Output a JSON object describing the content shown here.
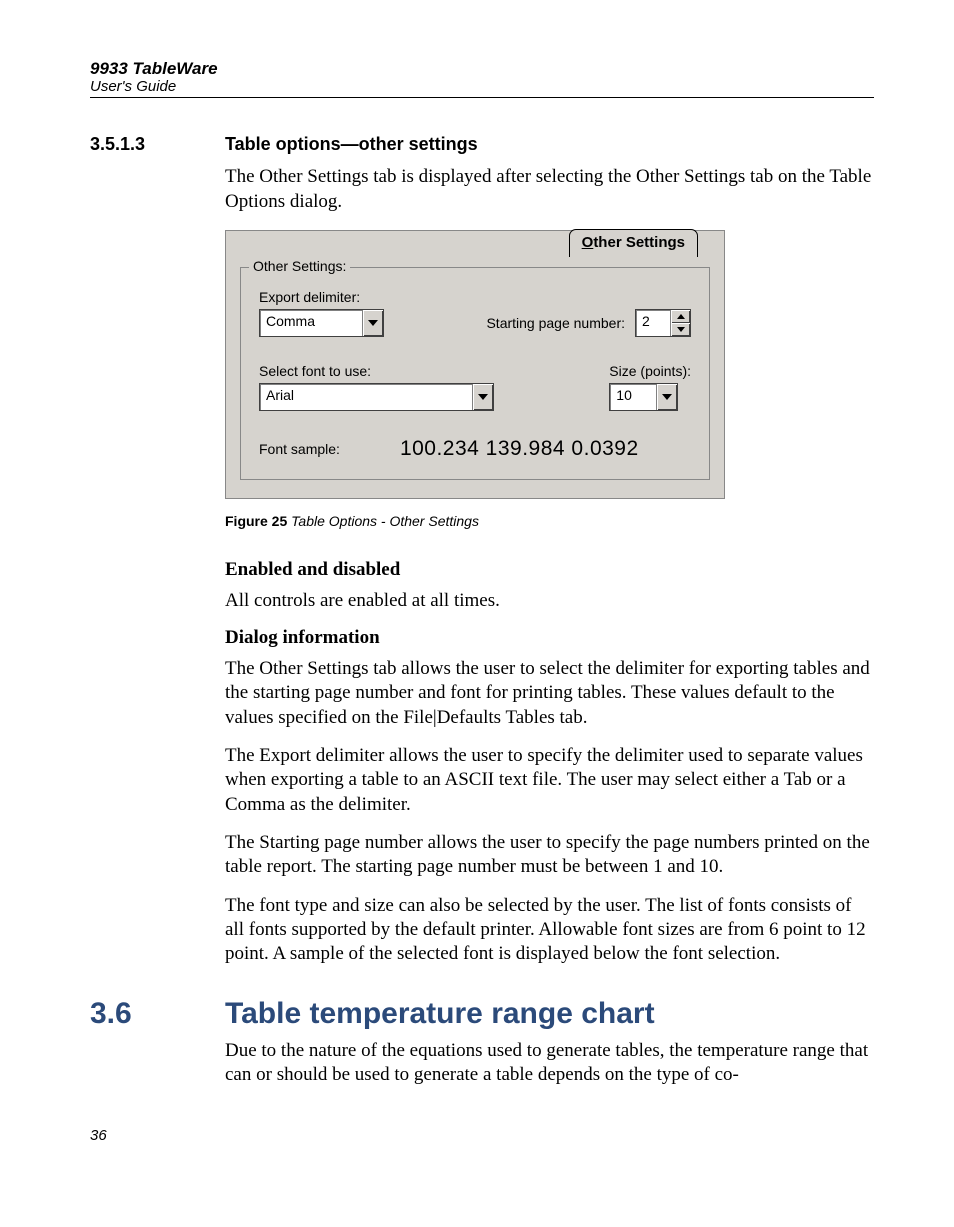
{
  "running_head": {
    "title": "9933 TableWare",
    "sub": "User's Guide"
  },
  "sec3513": {
    "num": "3.5.1.3",
    "title": "Table options—other settings",
    "intro": "The Other Settings tab is displayed after selecting the Other Settings  tab on the Table Options dialog."
  },
  "dialog": {
    "tab_prefix": "O",
    "tab_rest": "ther Settings",
    "group_legend": "Other Settings:",
    "export_label": "Export delimiter:",
    "export_value": "Comma",
    "start_label": "Starting page number:",
    "start_value": "2",
    "font_label": "Select font to use:",
    "font_value": "Arial",
    "size_label": "Size (points):",
    "size_value": "10",
    "sample_label": "Font sample:",
    "sample_value": "100.234 139.984 0.0392"
  },
  "figcap": {
    "bold": "Figure 25",
    "rest": "   Table Options - Other Settings"
  },
  "enabled": {
    "head": "Enabled and disabled",
    "body": "All controls are enabled at all times."
  },
  "info": {
    "head": "Dialog information",
    "p1": "The Other Settings tab allows the user to select the delimiter for exporting tables and the starting page number and font for printing tables. These values default to the values specified on the File|Defaults Tables tab.",
    "p2": "The Export delimiter allows the user to specify the delimiter used to separate values when exporting a table to an ASCII text file. The user may select either a Tab or a Comma as the delimiter.",
    "p3": "The Starting page number allows the user to specify the page numbers printed on the table report. The starting page number must be between 1 and 10.",
    "p4": "The font type and size can also be selected by the user. The list of fonts consists of all fonts supported by the default printer. Allowable font sizes are from 6 point to 12 point. A sample of the selected font is displayed below the font selection."
  },
  "sec36": {
    "num": "3.6",
    "title": "Table temperature range chart",
    "body": "Due to the nature of the equations used to generate tables, the temperature range that can or should be used to generate a table depends on the type of co-"
  },
  "page_number": "36"
}
